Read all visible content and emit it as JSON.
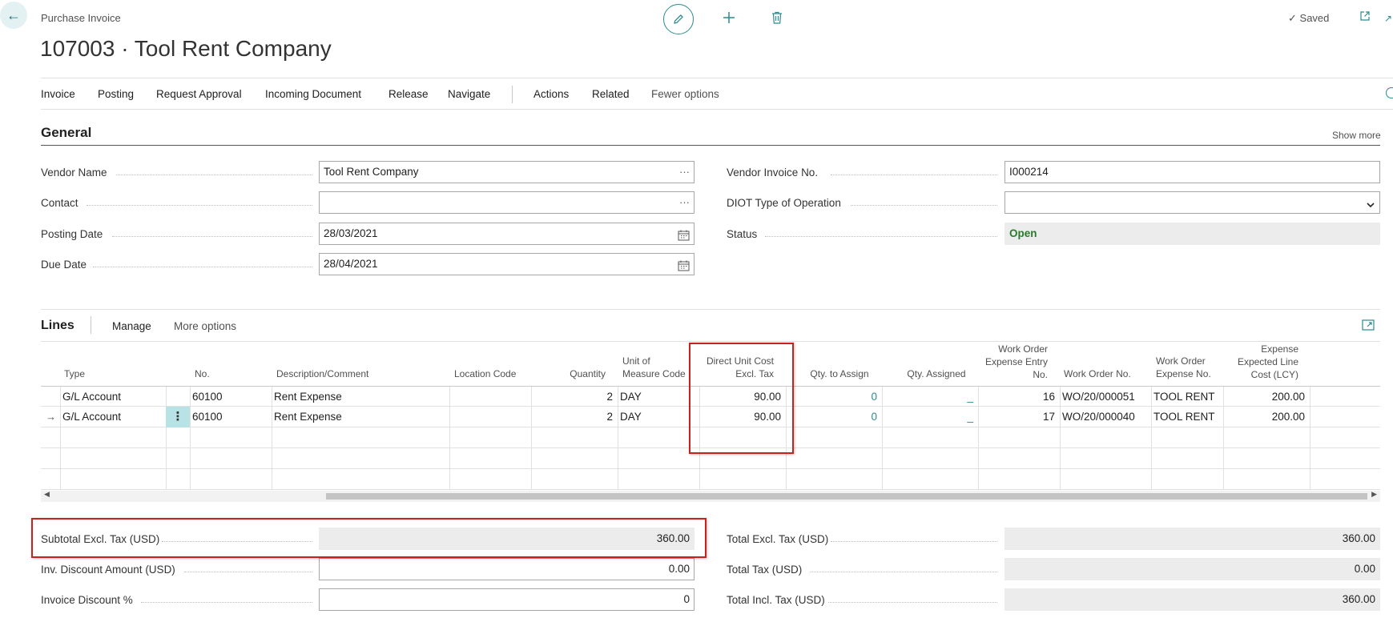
{
  "header": {
    "caption": "Purchase Invoice",
    "title": "107003 · Tool Rent Company",
    "saved_label": "Saved"
  },
  "actionbar": {
    "items": [
      "Invoice",
      "Posting",
      "Request Approval",
      "Incoming Document",
      "Release",
      "Navigate",
      "Actions",
      "Related",
      "Fewer options"
    ]
  },
  "general": {
    "heading": "General",
    "show_more": "Show more",
    "vendor_name_label": "Vendor Name",
    "vendor_name_value": "Tool Rent Company",
    "contact_label": "Contact",
    "contact_value": "",
    "posting_date_label": "Posting Date",
    "posting_date_value": "28/03/2021",
    "due_date_label": "Due Date",
    "due_date_value": "28/04/2021",
    "vendor_invoice_no_label": "Vendor Invoice No.",
    "vendor_invoice_no_value": "I000214",
    "diot_label": "DIOT Type of Operation",
    "diot_value": "",
    "status_label": "Status",
    "status_value": "Open"
  },
  "lines": {
    "heading": "Lines",
    "manage": "Manage",
    "more_options": "More options",
    "columns": {
      "type": "Type",
      "no": "No.",
      "description": "Description/Comment",
      "location": "Location Code",
      "quantity": "Quantity",
      "uom_1": "Unit of",
      "uom_2": "Measure Code",
      "direct_cost_1": "Direct Unit Cost",
      "direct_cost_2": "Excl. Tax",
      "qty_to_assign": "Qty. to Assign",
      "qty_assigned": "Qty. Assigned",
      "wo_entry_1": "Work Order",
      "wo_entry_2": "Expense Entry",
      "wo_entry_3": "No.",
      "wo_no": "Work Order No.",
      "wo_exp_1": "Work Order",
      "wo_exp_2": "Expense No.",
      "exp_cost_1": "Expense",
      "exp_cost_2": "Expected Line",
      "exp_cost_3": "Cost (LCY)"
    },
    "rows": [
      {
        "type": "G/L Account",
        "no": "60100",
        "description": "Rent Expense",
        "location": "",
        "quantity": "2",
        "uom": "DAY",
        "direct_cost": "90.00",
        "qty_to_assign": "0",
        "qty_assigned": "_",
        "wo_entry": "16",
        "wo_no": "WO/20/000051",
        "wo_exp": "TOOL RENT",
        "exp_cost": "200.00"
      },
      {
        "type": "G/L Account",
        "no": "60100",
        "description": "Rent Expense",
        "location": "",
        "quantity": "2",
        "uom": "DAY",
        "direct_cost": "90.00",
        "qty_to_assign": "0",
        "qty_assigned": "_",
        "wo_entry": "17",
        "wo_no": "WO/20/000040",
        "wo_exp": "TOOL RENT",
        "exp_cost": "200.00"
      }
    ]
  },
  "totals": {
    "subtotal_label": "Subtotal Excl. Tax (USD)",
    "subtotal_value": "360.00",
    "inv_discount_label": "Inv. Discount Amount (USD)",
    "inv_discount_value": "0.00",
    "invoice_discount_pct_label": "Invoice Discount %",
    "invoice_discount_pct_value": "0",
    "total_excl_label": "Total Excl. Tax (USD)",
    "total_excl_value": "360.00",
    "total_tax_label": "Total Tax (USD)",
    "total_tax_value": "0.00",
    "total_incl_label": "Total Incl. Tax (USD)",
    "total_incl_value": "360.00"
  },
  "colors": {
    "accent": "#2d8a8e",
    "highlight": "#c9211e",
    "status_open": "#2b7a2b"
  },
  "icons": [
    "back-arrow-icon",
    "pencil-icon",
    "plus-icon",
    "trash-icon",
    "checkmark-icon",
    "popout-icon",
    "collapse-icon",
    "info-icon",
    "ellipsis-icon",
    "calendar-icon",
    "chevron-down-icon",
    "expand-icon",
    "row-arrow-icon",
    "kebab-icon",
    "scroll-left-icon",
    "scroll-right-icon"
  ]
}
